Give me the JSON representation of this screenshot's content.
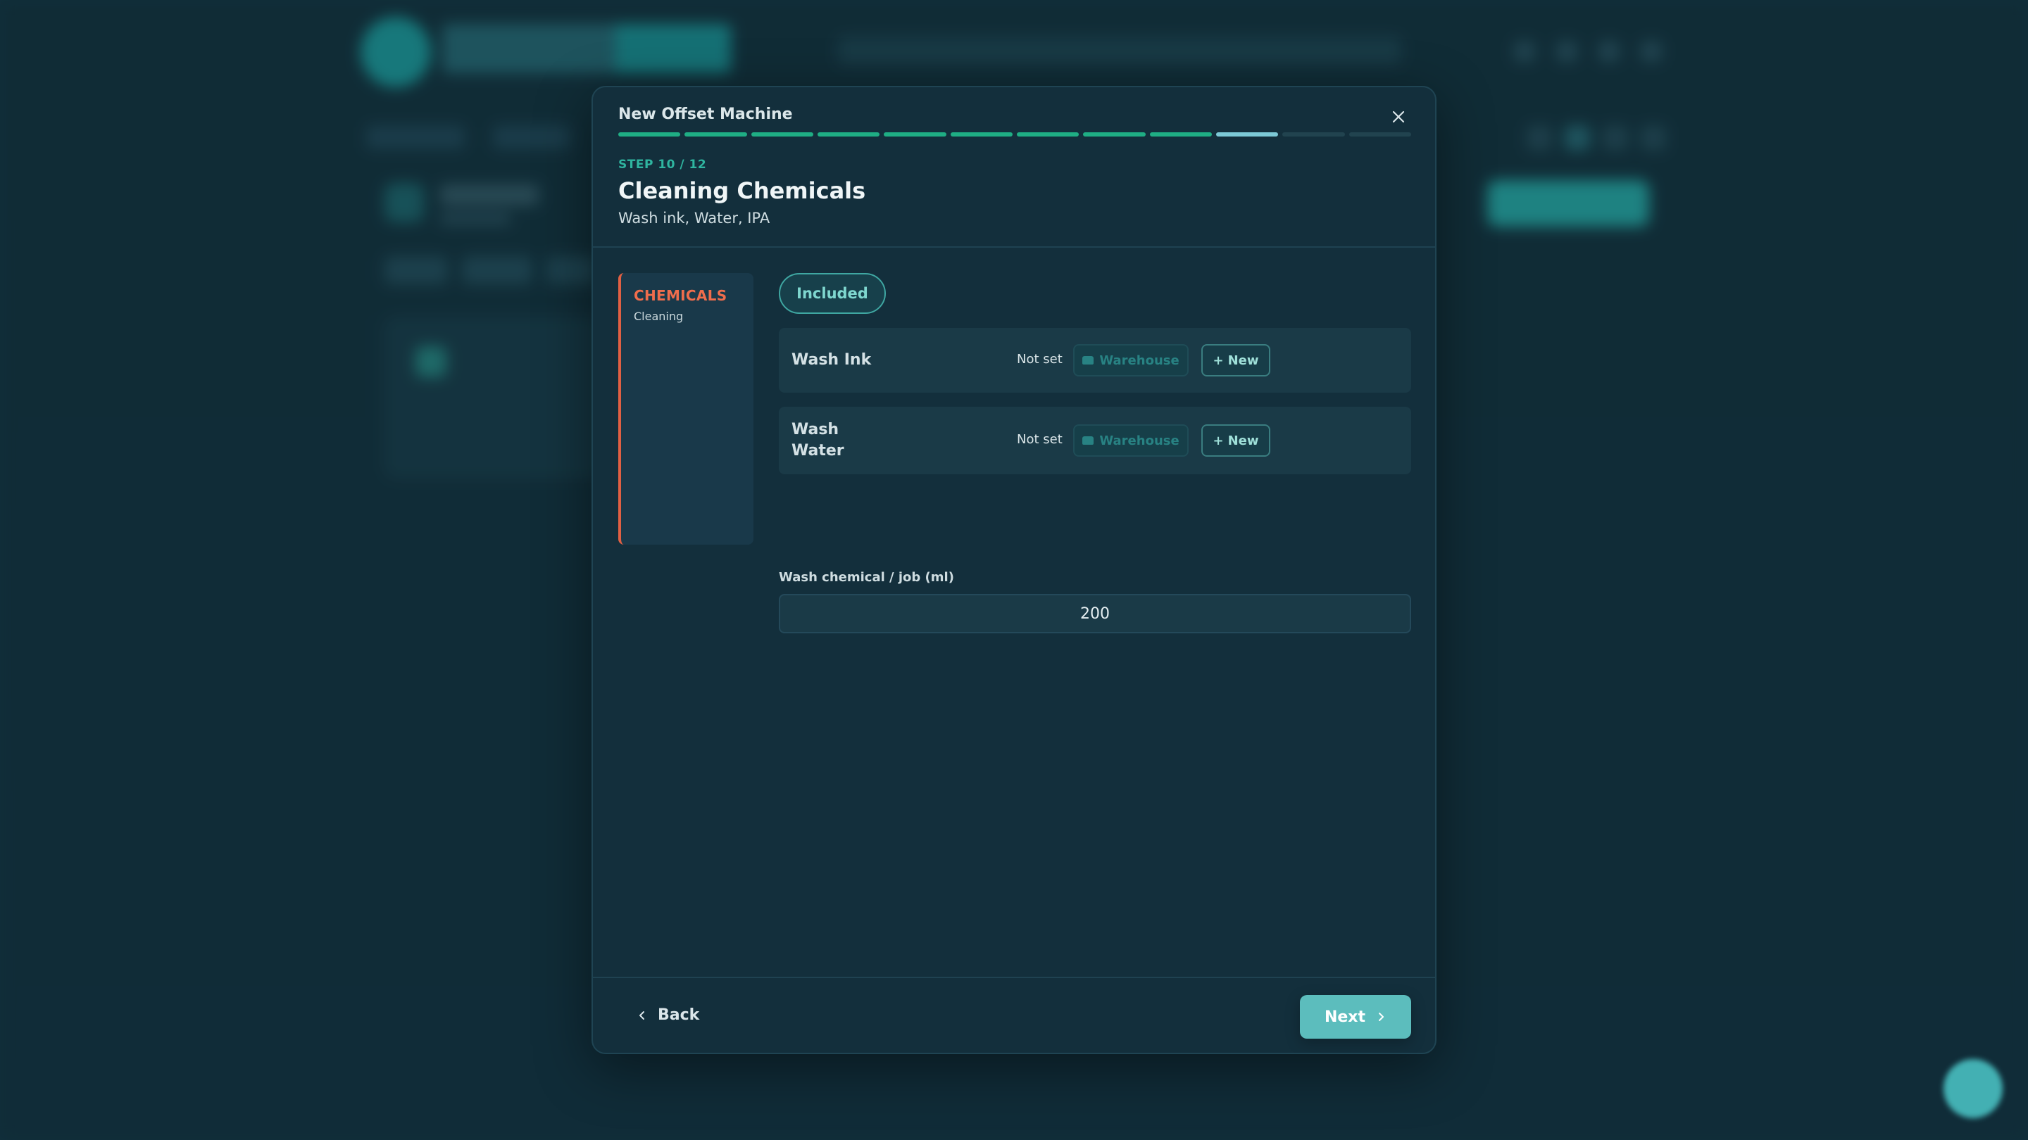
{
  "modal": {
    "title": "New Offset Machine",
    "progress": {
      "current_step": 10,
      "total_steps": 12,
      "completed_steps": 9
    },
    "step_label": "STEP 10 / 12",
    "step_title": "Cleaning Chemicals",
    "step_subtitle": "Wash ink, Water, IPA"
  },
  "section": {
    "name": "CHEMICALS",
    "subtitle": "Cleaning"
  },
  "content": {
    "included_label": "Included",
    "items": [
      {
        "name": "Wash Ink",
        "status": "Not set",
        "warehouse_label": "Warehouse",
        "new_label": "New"
      },
      {
        "name": "Wash Water",
        "status": "Not set",
        "warehouse_label": "Warehouse",
        "new_label": "New"
      }
    ],
    "field": {
      "label": "Wash chemical / job (ml)",
      "value": "200"
    }
  },
  "footer": {
    "back_label": "Back",
    "next_label": "Next"
  },
  "colors": {
    "accent": "#5cbdbd",
    "progress_done": "#1fae84",
    "progress_current": "#7cc9d6",
    "section_accent": "#e06043"
  },
  "icons": {
    "close": "close-icon",
    "back": "chevron-left-icon",
    "next": "chevron-right-icon",
    "warehouse": "warehouse-icon",
    "new": "plus-icon"
  }
}
